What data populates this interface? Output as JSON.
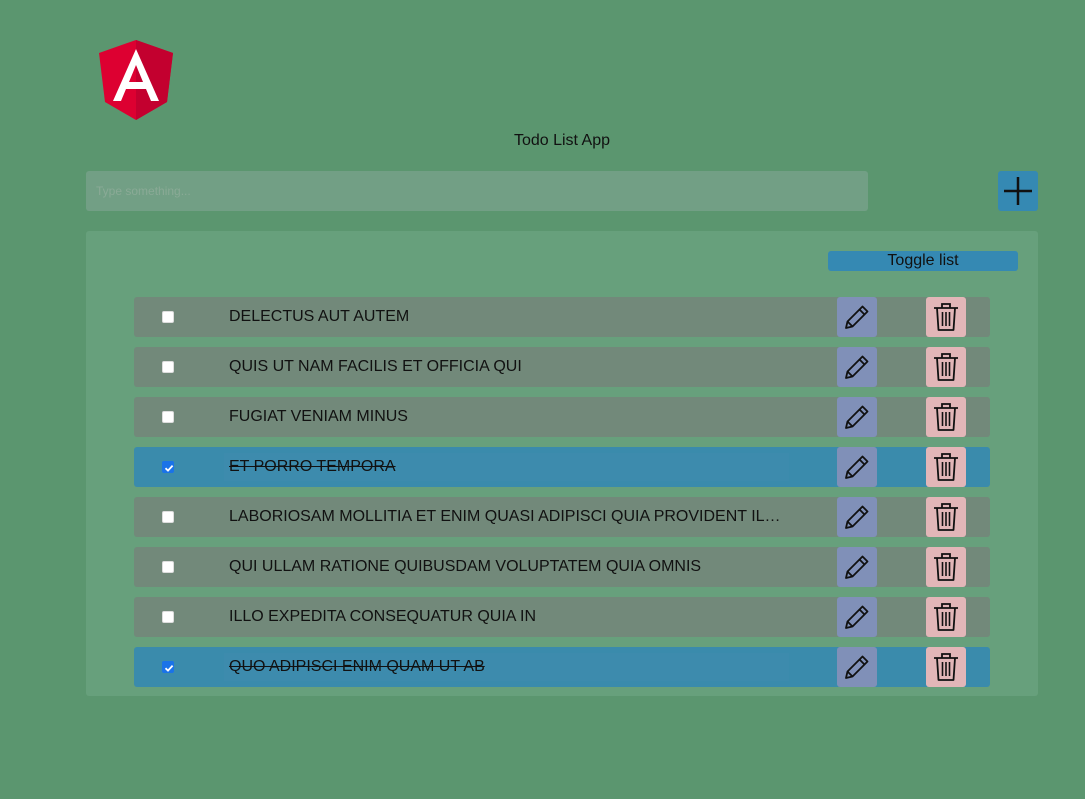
{
  "app": {
    "title": "Todo List App",
    "logo_icon": "angular-logo-icon"
  },
  "input": {
    "placeholder": "Type something...",
    "value": ""
  },
  "add_button": {
    "icon": "plus-icon"
  },
  "toggle_button": {
    "label": "Toggle list"
  },
  "colors": {
    "background": "#5b966f",
    "accent": "#3589b3",
    "edit": "#8090b8",
    "delete": "#e2b6b8",
    "row": "#72897a"
  },
  "todos": [
    {
      "title": "DELECTUS AUT AUTEM",
      "completed": false
    },
    {
      "title": "QUIS UT NAM FACILIS ET OFFICIA QUI",
      "completed": false
    },
    {
      "title": "FUGIAT VENIAM MINUS",
      "completed": false
    },
    {
      "title": "ET PORRO TEMPORA",
      "completed": true
    },
    {
      "title": "LABORIOSAM MOLLITIA ET ENIM QUASI ADIPISCI QUIA PROVIDENT ILLUM",
      "completed": false
    },
    {
      "title": "QUI ULLAM RATIONE QUIBUSDAM VOLUPTATEM QUIA OMNIS",
      "completed": false
    },
    {
      "title": "ILLO EXPEDITA CONSEQUATUR QUIA IN",
      "completed": false
    },
    {
      "title": "QUO ADIPISCI ENIM QUAM UT AB",
      "completed": true
    }
  ]
}
